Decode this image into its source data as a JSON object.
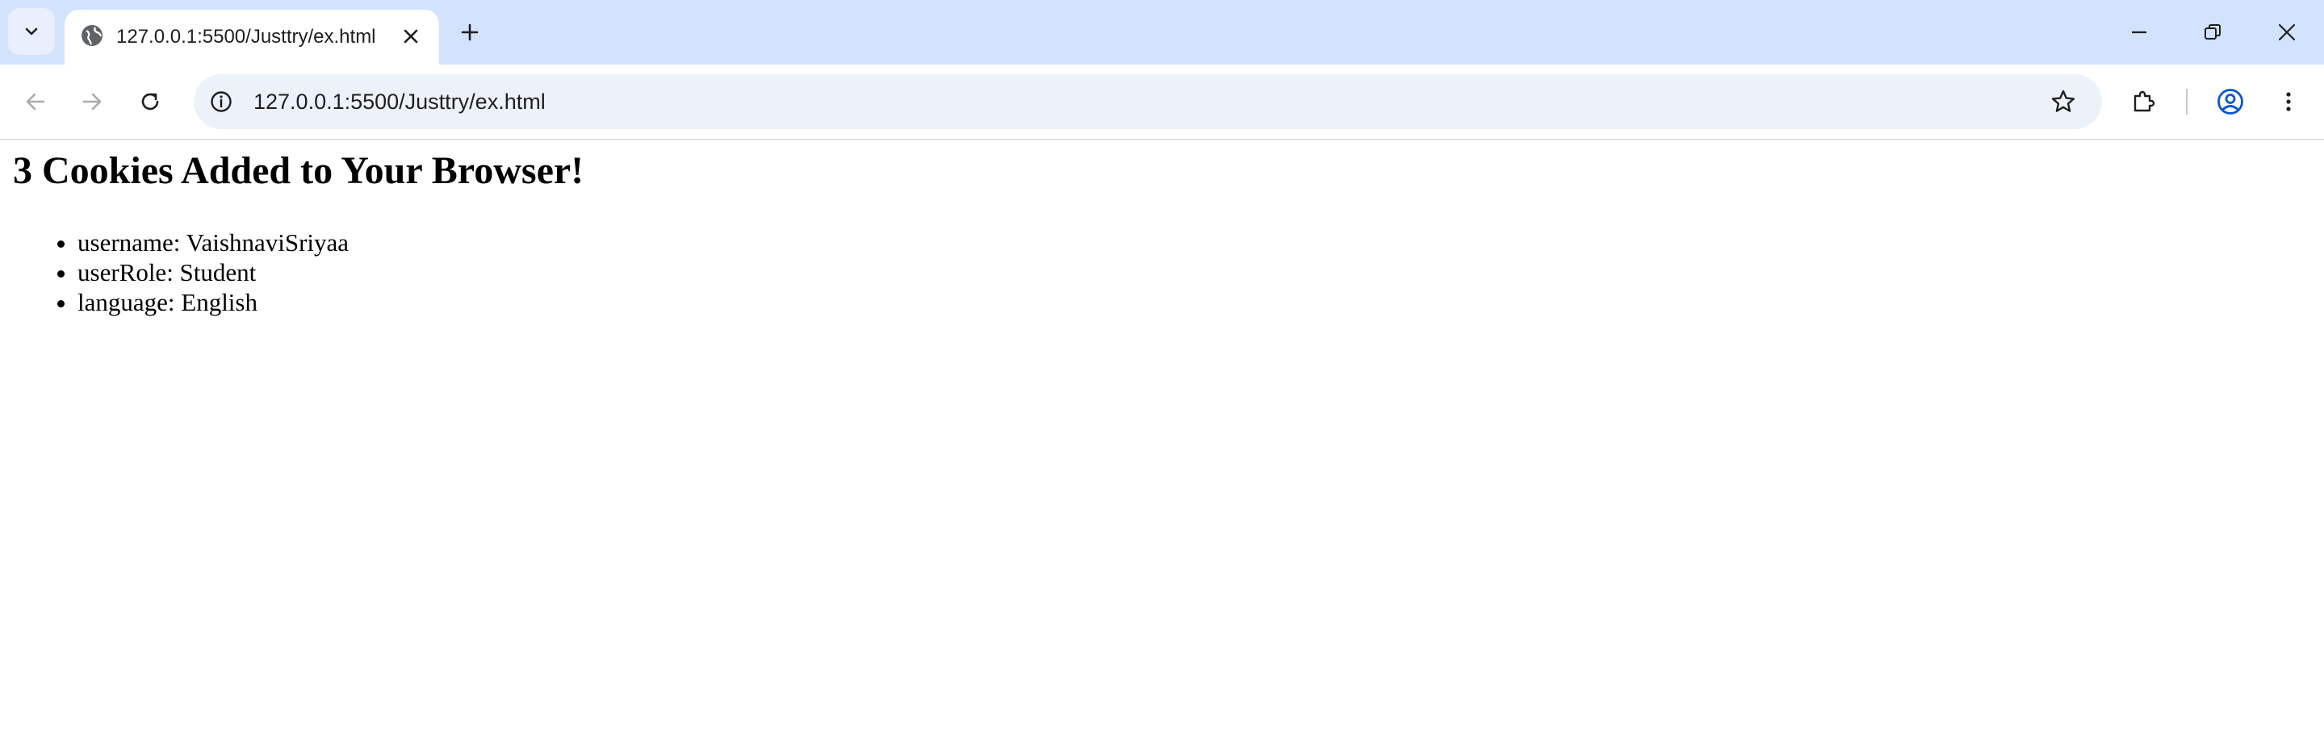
{
  "browser": {
    "tab": {
      "title": "127.0.0.1:5500/Justtry/ex.html"
    },
    "address_bar": {
      "url": "127.0.0.1:5500/Justtry/ex.html"
    }
  },
  "page": {
    "heading": "3 Cookies Added to Your Browser!",
    "cookies": [
      {
        "text": "username: VaishnaviSriyaa"
      },
      {
        "text": "userRole: Student"
      },
      {
        "text": "language: English"
      }
    ]
  }
}
